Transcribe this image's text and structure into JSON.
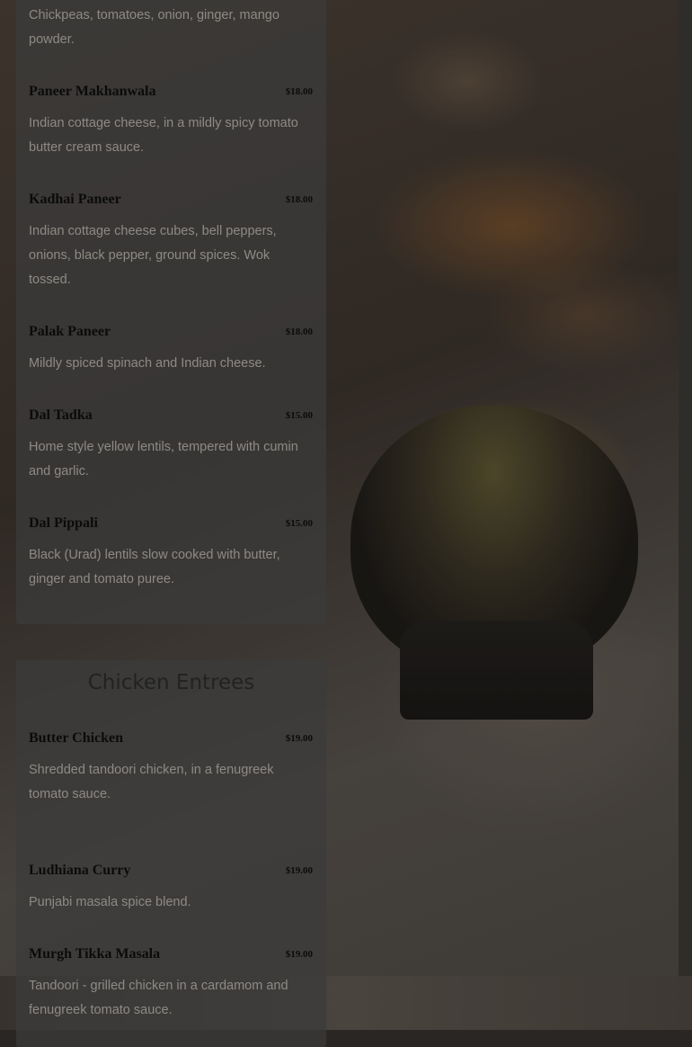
{
  "vegetarian_section": {
    "items": [
      {
        "desc": "Chickpeas, tomatoes, onion, ginger, mango powder."
      },
      {
        "name": "Paneer Makhanwala",
        "price": "$18.00",
        "desc": "Indian cottage cheese, in a mildly spicy tomato butter cream sauce."
      },
      {
        "name": "Kadhai Paneer",
        "price": "$18.00",
        "desc": "Indian cottage cheese cubes, bell peppers, onions, black pepper, ground spices. Wok tossed."
      },
      {
        "name": "Palak Paneer",
        "price": "$18.00",
        "desc": "Mildly spiced spinach and Indian cheese."
      },
      {
        "name": "Dal Tadka",
        "price": "$15.00",
        "desc": "Home style yellow lentils, tempered with cumin and garlic."
      },
      {
        "name": "Dal Pippali",
        "price": "$15.00",
        "desc": "Black (Urad) lentils slow cooked with butter, ginger and tomato puree."
      }
    ]
  },
  "chicken_section": {
    "title": "Chicken Entrees",
    "items": [
      {
        "name": "Butter Chicken",
        "price": "$19.00",
        "desc": "Shredded tandoori chicken, in a fenugreek tomato sauce."
      },
      {
        "name": "Ludhiana Curry",
        "price": "$19.00",
        "desc": "Punjabi masala spice blend."
      },
      {
        "name": "Murgh Tikka Masala",
        "price": "$19.00",
        "desc": "Tandoori - grilled chicken in a cardamom and fenugreek tomato sauce."
      }
    ]
  }
}
